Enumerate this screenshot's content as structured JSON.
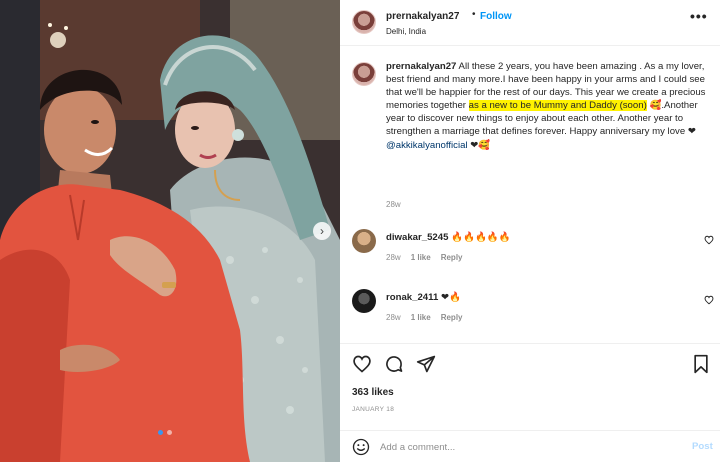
{
  "post": {
    "username": "prernakalyan27",
    "follow_label": "Follow",
    "separator": "•",
    "location": "Delhi, India",
    "more_label": "•••",
    "caption": {
      "username": "prernakalyan27",
      "text_before": " All these 2 years, you have been amazing . As a my lover, best friend and many more.I have been happy in your arms and I could see that we'll be happier for the rest of our days. This year we create a precious memories together ",
      "highlight": "as a new to be Mummy and Daddy (soon)",
      "emoji_1": "🥰",
      "text_after": ".Another year to discover new things to enjoy about each other. Another year to strengthen a marriage that defines forever. Happy anniversary my love ",
      "heart": "❤",
      "mention": "@akkikalyanofficial",
      "after_mention": " ❤🥰",
      "time": "28w"
    },
    "comments": [
      {
        "username": "diwakar_5245",
        "text": "🔥🔥🔥🔥🔥",
        "time": "28w",
        "likes": "1 like",
        "reply": "Reply",
        "avatar_color": "#8a6a4a"
      },
      {
        "username": "ronak_2411",
        "text": "❤🔥",
        "time": "28w",
        "likes": "1 like",
        "reply": "Reply",
        "avatar_color": "#1a1a1a"
      }
    ],
    "likes": "363 likes",
    "date": "JANUARY 18",
    "add_comment": {
      "placeholder": "Add a comment...",
      "post_label": "Post"
    },
    "colors": {
      "accent": "#0095f6",
      "highlight": "#fff200",
      "muted": "#8e8e8e"
    },
    "icons": {
      "like": "heart-icon",
      "comment": "comment-icon",
      "share": "paper-plane-icon",
      "save": "bookmark-icon",
      "emoji": "smiley-icon",
      "carousel": "chevron-right-icon"
    },
    "carousel": {
      "next_label": "›",
      "slides": 2,
      "active": 1
    }
  }
}
